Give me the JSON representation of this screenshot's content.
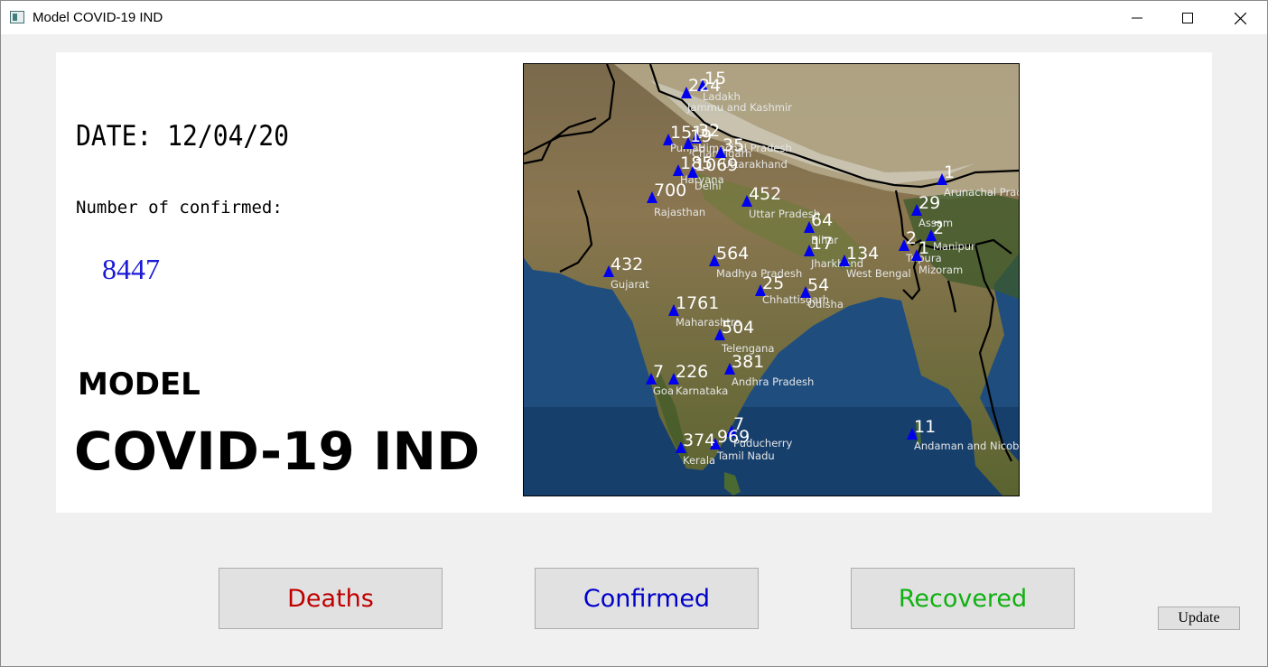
{
  "window": {
    "title": "Model COVID-19 IND",
    "app_icon": "app-window-icon"
  },
  "window_controls": [
    "minimize-icon",
    "maximize-icon",
    "close-icon"
  ],
  "info": {
    "date_label": "DATE: 12/04/20",
    "confirmed_label": "Number of confirmed:",
    "confirmed_count": "8447",
    "model_label": "MODEL",
    "app_title": "COVID-19 IND"
  },
  "map": {
    "marker_color": "#0000ee",
    "states": [
      {
        "name": "Ladakh",
        "value": "15"
      },
      {
        "name": "Jammu and Kashmir",
        "value": "224"
      },
      {
        "name": "Punjab",
        "value": "151"
      },
      {
        "name": "Himachal Pradesh",
        "value": "32"
      },
      {
        "name": "Chandigarh",
        "value": "19"
      },
      {
        "name": "Uttarakhand",
        "value": "35"
      },
      {
        "name": "Haryana",
        "value": "185"
      },
      {
        "name": "Delhi",
        "value": "1069"
      },
      {
        "name": "Rajasthan",
        "value": "700"
      },
      {
        "name": "Uttar Pradesh",
        "value": "452"
      },
      {
        "name": "Arunachal Pradesh",
        "value": "1"
      },
      {
        "name": "Assam",
        "value": "29"
      },
      {
        "name": "Manipur",
        "value": "2"
      },
      {
        "name": "Tripura",
        "value": "2"
      },
      {
        "name": "Mizoram",
        "value": "1"
      },
      {
        "name": "Bihar",
        "value": "64"
      },
      {
        "name": "Jharkhand",
        "value": "17"
      },
      {
        "name": "West Bengal",
        "value": "134"
      },
      {
        "name": "Gujarat",
        "value": "432"
      },
      {
        "name": "Madhya Pradesh",
        "value": "564"
      },
      {
        "name": "Chhattisgarh",
        "value": "25"
      },
      {
        "name": "Odisha",
        "value": "54"
      },
      {
        "name": "Maharashtra",
        "value": "1761"
      },
      {
        "name": "Telengana",
        "value": "504"
      },
      {
        "name": "Goa",
        "value": "7"
      },
      {
        "name": "Karnataka",
        "value": "226"
      },
      {
        "name": "Andhra Pradesh",
        "value": "381"
      },
      {
        "name": "Puducherry",
        "value": "7"
      },
      {
        "name": "Tamil Nadu",
        "value": "969"
      },
      {
        "name": "Kerala",
        "value": "374"
      },
      {
        "name": "Andaman and Nicobar",
        "value": "11"
      }
    ]
  },
  "buttons": {
    "deaths": "Deaths",
    "confirmed": "Confirmed",
    "recovered": "Recovered",
    "update": "Update"
  },
  "colors": {
    "deaths": "#c00000",
    "confirmed": "#0000cc",
    "recovered": "#10b010",
    "confirmed_count": "#1a1ad6"
  }
}
